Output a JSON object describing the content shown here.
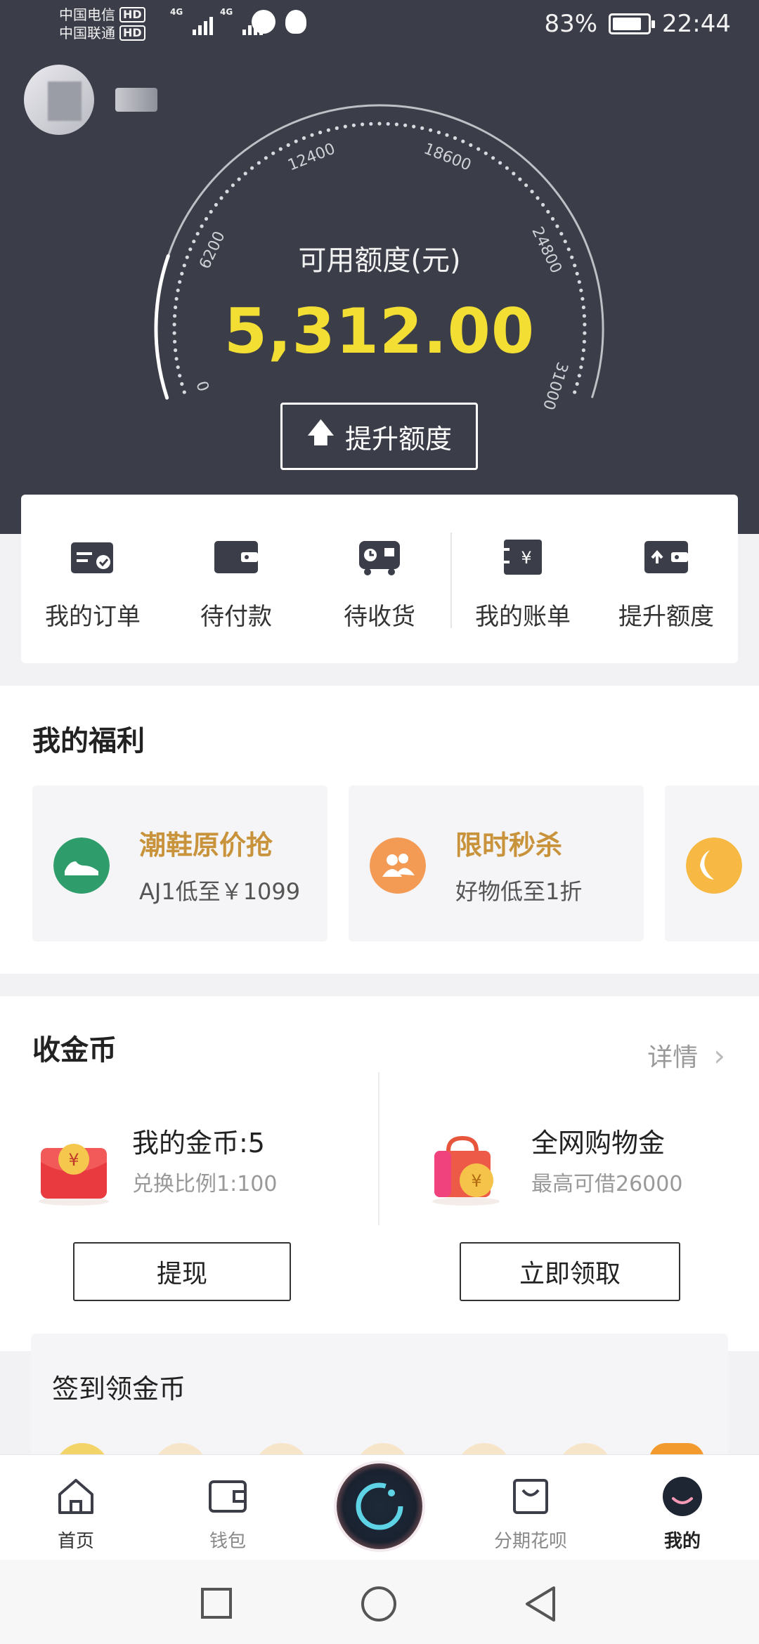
{
  "status_bar": {
    "carrier1": "中国电信",
    "carrier2": "中国联通",
    "hd": "HD",
    "net1": "4G",
    "net2": "4G",
    "battery": "83%",
    "battery_level": 0.83,
    "time": "22:44"
  },
  "gauge": {
    "ticks": [
      "0",
      "6200",
      "12400",
      "18600",
      "24800",
      "31000"
    ],
    "label": "可用额度(元)",
    "value": "5,312.00",
    "raise_button": "提升额度",
    "max": 31000,
    "current": 5312
  },
  "quick_menu": {
    "items": [
      {
        "label": "我的订单",
        "icon": "order-icon"
      },
      {
        "label": "待付款",
        "icon": "wallet-icon"
      },
      {
        "label": "待收货",
        "icon": "truck-icon"
      },
      {
        "label": "我的账单",
        "icon": "bill-icon"
      },
      {
        "label": "提升额度",
        "icon": "raise-limit-icon"
      }
    ]
  },
  "welfare": {
    "title": "我的福利",
    "cards": [
      {
        "title": "潮鞋原价抢",
        "subtitle": "AJ1低至￥1099",
        "icon": "sneaker-icon",
        "color": "#2f9d6b"
      },
      {
        "title": "限时秒杀",
        "subtitle": "好物低至1折",
        "icon": "group-icon",
        "color": "#f39a55"
      },
      {
        "title": "",
        "subtitle": "",
        "icon": "moon-icon",
        "color": "#f7b944"
      }
    ]
  },
  "coins": {
    "title": "收金币",
    "detail_link": "详情",
    "my_coins": {
      "title": "我的金币:5",
      "subtitle": "兑换比例1:100",
      "button": "提现"
    },
    "shopping": {
      "title": "全网购物金",
      "subtitle": "最高可借26000",
      "button": "立即领取"
    }
  },
  "signin": {
    "title": "签到领金币"
  },
  "tabbar": {
    "items": [
      {
        "label": "首页",
        "icon": "home-icon"
      },
      {
        "label": "钱包",
        "icon": "wallet-icon"
      },
      {
        "label": "",
        "icon": "center-logo-icon"
      },
      {
        "label": "分期花呗",
        "icon": "shopping-bag-icon"
      },
      {
        "label": "我的",
        "icon": "profile-icon"
      }
    ],
    "active": "我的"
  },
  "colors": {
    "hero_bg": "#3b3e48",
    "credit_value": "#f3de33",
    "welfare_title": "#c8933b"
  }
}
